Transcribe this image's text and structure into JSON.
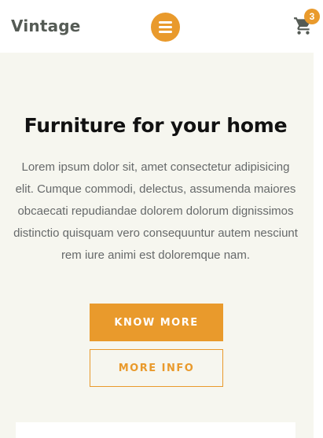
{
  "header": {
    "brand": "Vintage",
    "menu_icon": "hamburger-icon",
    "cart_icon": "cart-icon",
    "cart_count": "3"
  },
  "hero": {
    "title": "Furniture for your home",
    "description": "Lorem ipsum dolor sit, amet consectetur adipisicing elit. Cumque commodi, delectus, assumenda maiores obcaecati repudiandae dolorem dolorum dignissimos distinctio quisquam vero consequuntur autem nesciunt rem iure animi est doloremque nam.",
    "primary_button": "KNOW MORE",
    "secondary_button": "MORE INFO"
  },
  "colors": {
    "accent": "#e99a2c",
    "hero_background": "#f6f6ef",
    "brand_text": "#555b55"
  }
}
